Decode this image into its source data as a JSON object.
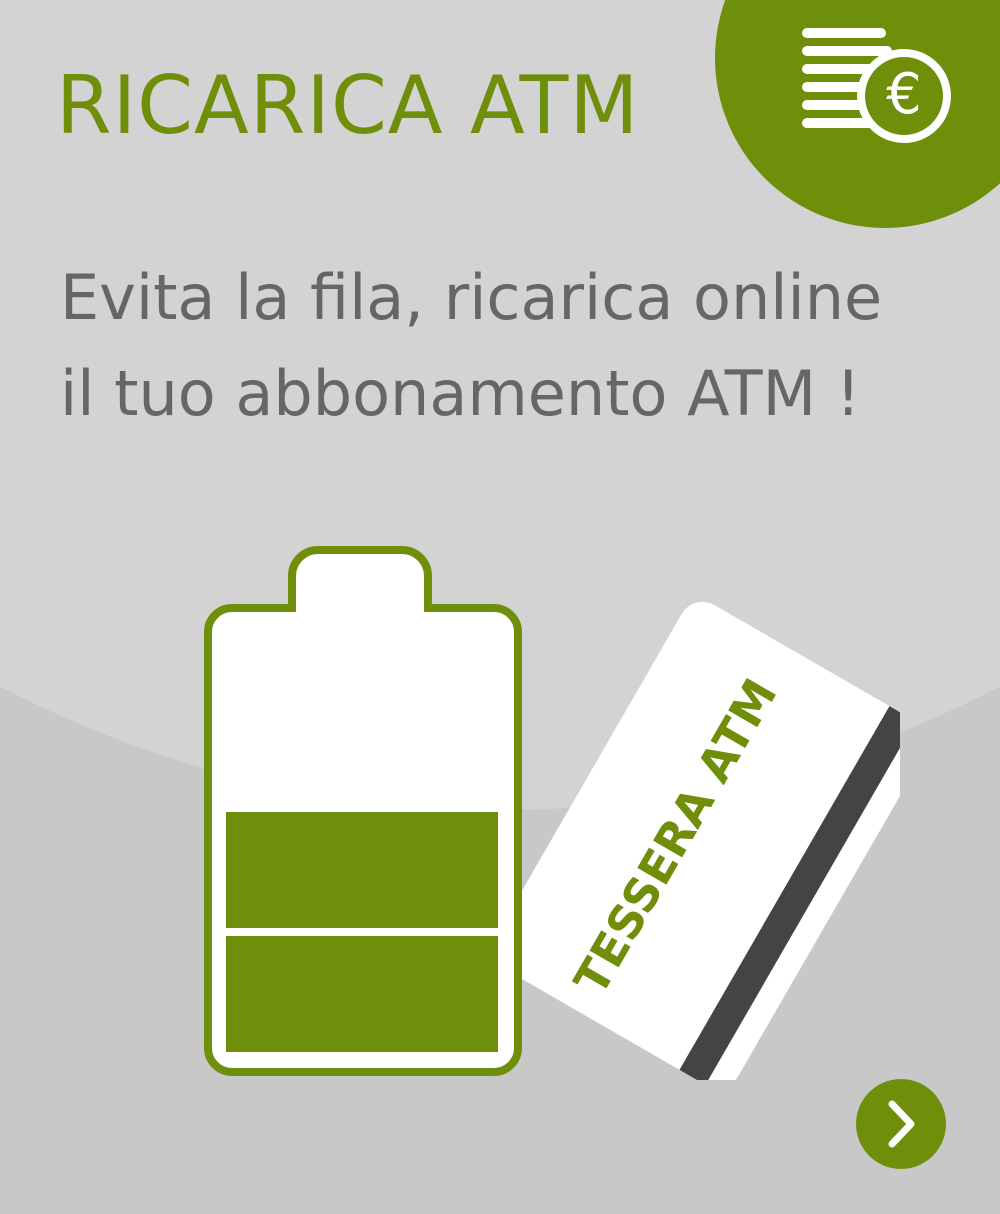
{
  "banner": {
    "title": "RICARICA ATM",
    "subtitle_lines": [
      "Evita la fila, ricarica online",
      "il tuo abbonamento ATM !"
    ],
    "card_label": "TESSERA ATM",
    "battery_level": 0.5,
    "icons": {
      "corner": "coins-euro-icon",
      "battery": "battery-icon",
      "card": "transit-card-icon",
      "next": "chevron-right-icon"
    },
    "colors": {
      "accent": "#6f8f0a",
      "background_light": "#d3d3d3",
      "background_dark": "#c8c8c8",
      "text_gray": "#666666",
      "card_white": "#ffffff",
      "card_stripe": "#444444"
    }
  }
}
